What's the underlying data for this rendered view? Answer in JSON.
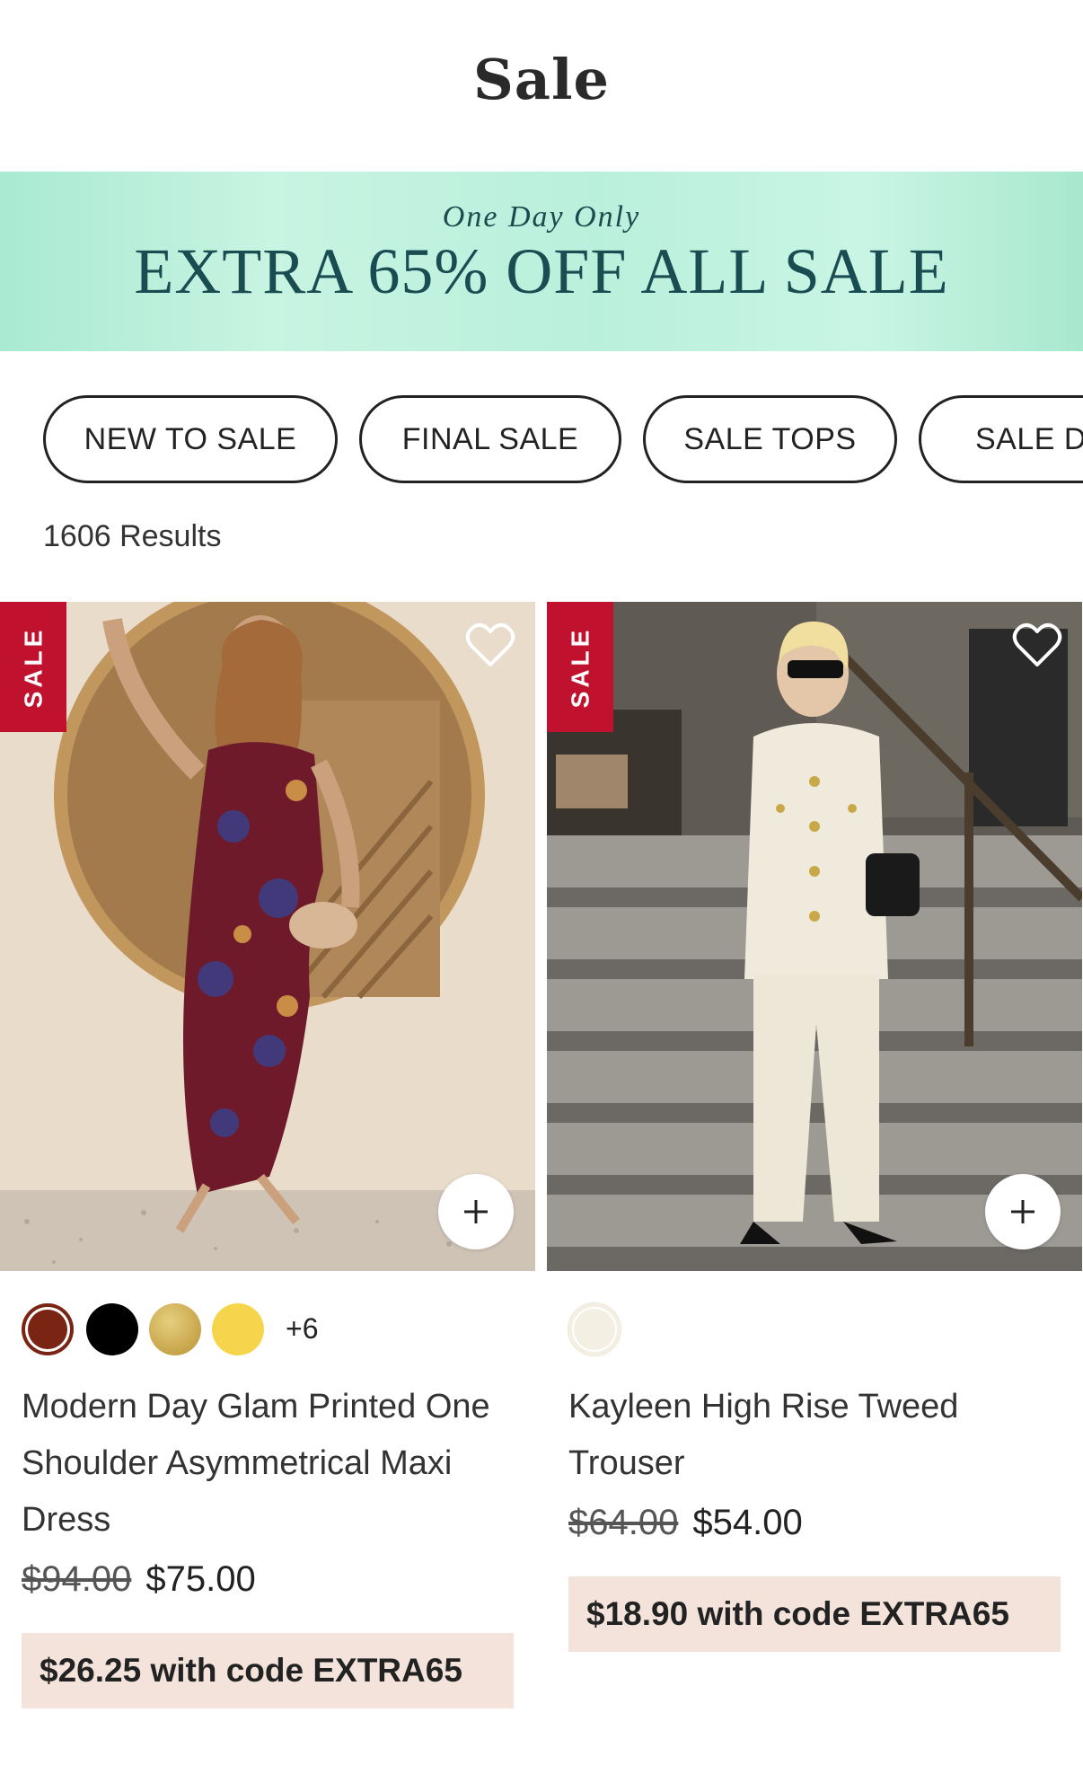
{
  "page": {
    "title": "Sale"
  },
  "promo": {
    "kicker": "One Day Only",
    "headline": "EXTRA 65% OFF ALL SALE",
    "colors": {
      "background": "#bdf1dc",
      "text": "#1a4d52"
    }
  },
  "chips": [
    {
      "label": "NEW TO SALE"
    },
    {
      "label": "FINAL SALE"
    },
    {
      "label": "SALE TOPS"
    },
    {
      "label": "SALE D"
    }
  ],
  "results": {
    "count": "1606",
    "label": "Results",
    "text": "1606  Results"
  },
  "products": [
    {
      "badge": "SALE",
      "image_icon": "model-photo-floral-maxi-dress",
      "swatches": [
        "#7a2414",
        "#000000",
        "#c9a84a",
        "#f6d54c"
      ],
      "swatches_more": "+6",
      "name": "Modern Day Glam Printed One Shoulder Asymmetrical Maxi Dress",
      "price_original": "$94.00",
      "price_sale": "$75.00",
      "promo_price": "$26.25 with code EXTRA65"
    },
    {
      "badge": "SALE",
      "image_icon": "model-photo-white-tweed-set",
      "swatches": [
        "#f4efe3"
      ],
      "swatches_more": "",
      "name": "Kayleen High Rise Tweed Trouser",
      "price_original": "$64.00",
      "price_sale": "$54.00",
      "promo_price": "$18.90 with code EXTRA65"
    }
  ],
  "colors": {
    "sale_badge": "#c0122e",
    "promo_code_bg": "#f3e3da"
  }
}
